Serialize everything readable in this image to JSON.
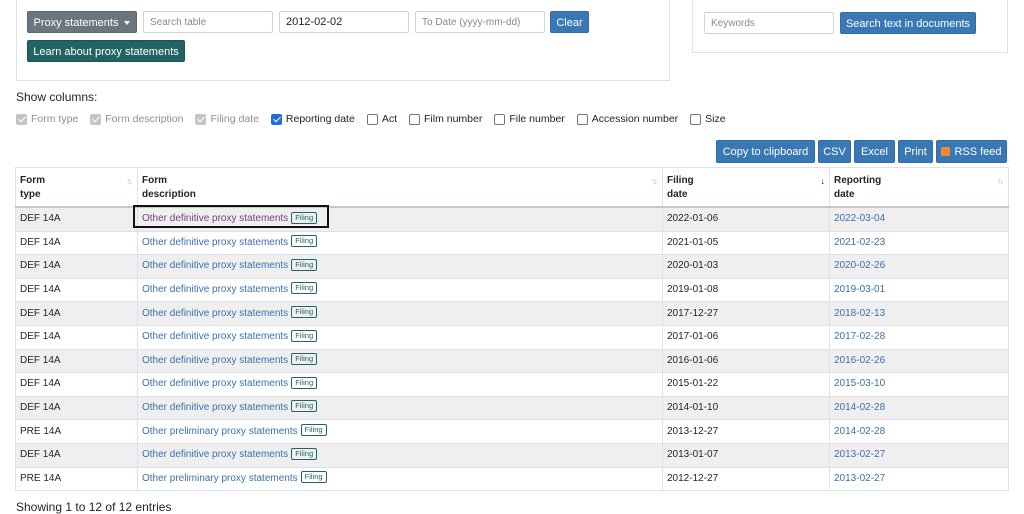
{
  "filters": {
    "form_group_label": "Proxy statements",
    "search_table_placeholder": "Search table",
    "from_date_value": "2012-02-02",
    "to_date_placeholder": "To Date (yyyy-mm-dd)",
    "clear_label": "Clear",
    "learn_label": "Learn about proxy statements"
  },
  "fulltext": {
    "keywords_placeholder": "Keywords",
    "search_label": "Search text in documents"
  },
  "show_columns": {
    "heading": "Show columns:",
    "options": [
      {
        "label": "Form type",
        "checked": true,
        "disabled": true
      },
      {
        "label": "Form description",
        "checked": true,
        "disabled": true
      },
      {
        "label": "Filing date",
        "checked": true,
        "disabled": true
      },
      {
        "label": "Reporting date",
        "checked": true,
        "disabled": false
      },
      {
        "label": "Act",
        "checked": false,
        "disabled": false
      },
      {
        "label": "Film number",
        "checked": false,
        "disabled": false
      },
      {
        "label": "File number",
        "checked": false,
        "disabled": false
      },
      {
        "label": "Accession number",
        "checked": false,
        "disabled": false
      },
      {
        "label": "Size",
        "checked": false,
        "disabled": false
      }
    ]
  },
  "export": {
    "copy_label": "Copy to clipboard",
    "csv_label": "CSV",
    "excel_label": "Excel",
    "print_label": "Print",
    "rss_label": "RSS feed"
  },
  "table": {
    "headers": {
      "form_type_line1": "Form",
      "form_type_line2": "type",
      "desc_line1": "Form",
      "desc_line2": "description",
      "filing_line1": "Filing",
      "filing_line2": "date",
      "reporting_line1": "Reporting",
      "reporting_line2": "date"
    },
    "badge_label": "Filing",
    "rows": [
      {
        "form": "DEF 14A",
        "desc": "Other definitive proxy statements",
        "filing": "2022-01-06",
        "reporting": "2022-03-04"
      },
      {
        "form": "DEF 14A",
        "desc": "Other definitive proxy statements",
        "filing": "2021-01-05",
        "reporting": "2021-02-23"
      },
      {
        "form": "DEF 14A",
        "desc": "Other definitive proxy statements",
        "filing": "2020-01-03",
        "reporting": "2020-02-26"
      },
      {
        "form": "DEF 14A",
        "desc": "Other definitive proxy statements",
        "filing": "2019-01-08",
        "reporting": "2019-03-01"
      },
      {
        "form": "DEF 14A",
        "desc": "Other definitive proxy statements",
        "filing": "2017-12-27",
        "reporting": "2018-02-13"
      },
      {
        "form": "DEF 14A",
        "desc": "Other definitive proxy statements",
        "filing": "2017-01-06",
        "reporting": "2017-02-28"
      },
      {
        "form": "DEF 14A",
        "desc": "Other definitive proxy statements",
        "filing": "2016-01-06",
        "reporting": "2016-02-26"
      },
      {
        "form": "DEF 14A",
        "desc": "Other definitive proxy statements",
        "filing": "2015-01-22",
        "reporting": "2015-03-10"
      },
      {
        "form": "DEF 14A",
        "desc": "Other definitive proxy statements",
        "filing": "2014-01-10",
        "reporting": "2014-02-28"
      },
      {
        "form": "PRE 14A",
        "desc": "Other preliminary proxy statements",
        "filing": "2013-12-27",
        "reporting": "2014-02-28"
      },
      {
        "form": "DEF 14A",
        "desc": "Other definitive proxy statements",
        "filing": "2013-01-07",
        "reporting": "2013-02-27"
      },
      {
        "form": "PRE 14A",
        "desc": "Other preliminary proxy statements",
        "filing": "2012-12-27",
        "reporting": "2013-02-27"
      }
    ]
  },
  "footer": {
    "entries_text": "Showing 1 to 12 of 12 entries"
  }
}
